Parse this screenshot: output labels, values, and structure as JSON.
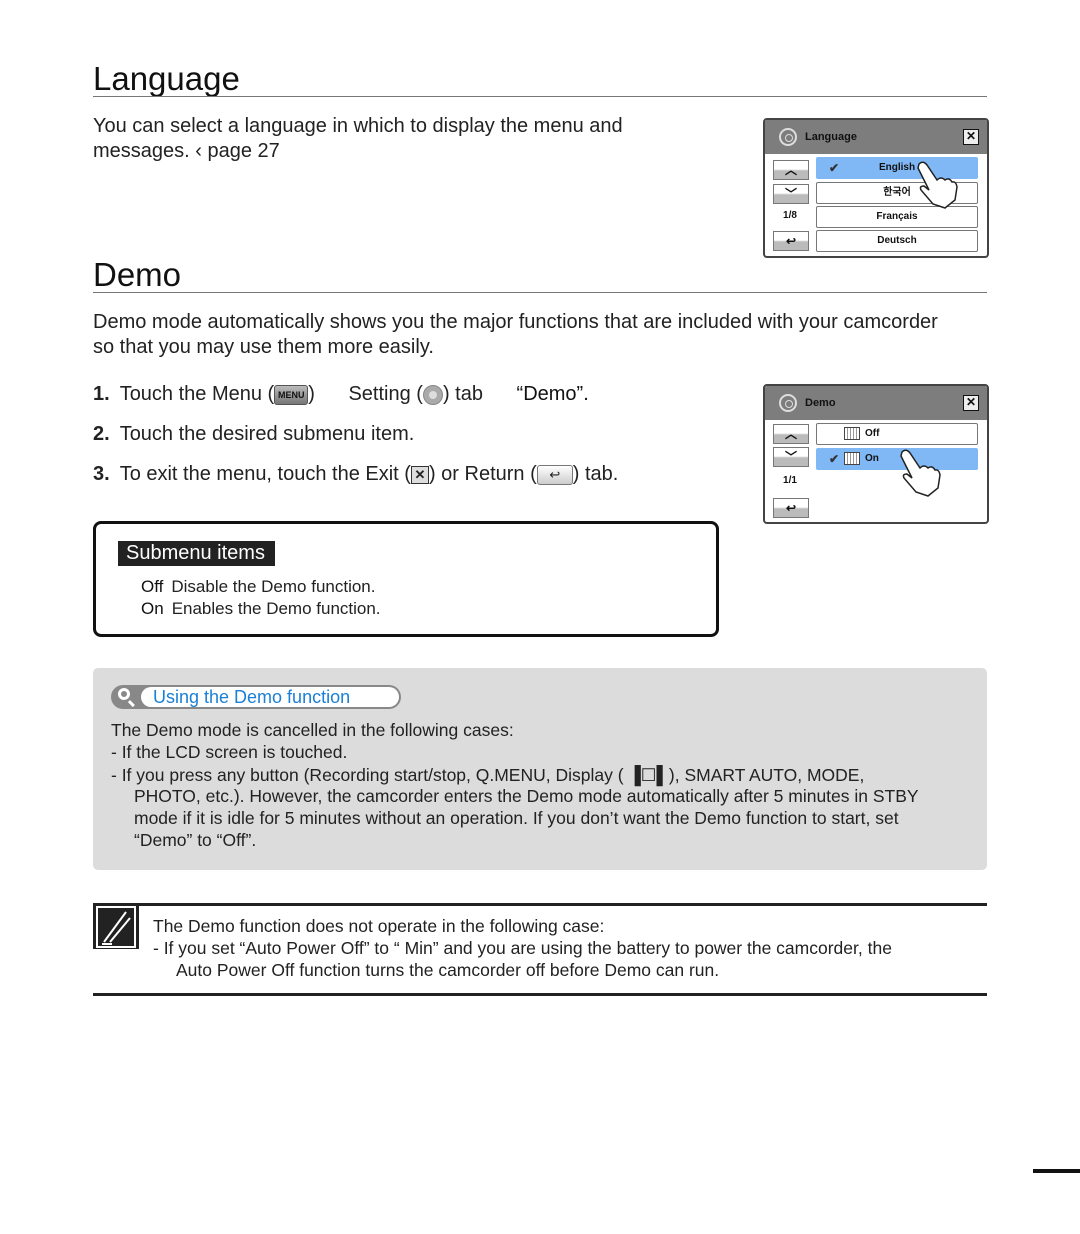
{
  "language_section": {
    "title": "Language",
    "description_line1": "You can select a language in which to display the menu and",
    "description_line2": "messages.  ‹ page 27",
    "screen": {
      "title": "Language",
      "page_indicator": "1/8",
      "options": [
        {
          "label": "English",
          "selected": true
        },
        {
          "label": "한국어",
          "selected": false
        },
        {
          "label": "Français",
          "selected": false
        },
        {
          "label": "Deutsch",
          "selected": false
        }
      ]
    }
  },
  "demo_section": {
    "title": "Demo",
    "description_line1": "Demo mode automatically shows you the major functions that are included with your camcorder",
    "description_line2": "so that you may use them more easily.",
    "steps": [
      {
        "num": "1.",
        "parts": [
          "Touch the Menu (",
          "MENU",
          ")",
          "Setting (",
          ") tab",
          "“Demo”."
        ]
      },
      {
        "num": "2.",
        "text": "Touch the desired submenu item."
      },
      {
        "num": "3.",
        "parts": [
          "To exit the menu, touch the Exit (",
          ") or Return (",
          ") tab."
        ]
      }
    ],
    "screen": {
      "title": "Demo",
      "page_indicator": "1/1",
      "options": [
        {
          "label": "Off",
          "selected": false
        },
        {
          "label": "On",
          "selected": true
        }
      ]
    },
    "submenu": {
      "title": "Submenu items",
      "items": [
        {
          "key": "Off",
          "desc": "Disable the Demo function."
        },
        {
          "key": "On",
          "desc": "Enables the Demo function."
        }
      ]
    }
  },
  "tip": {
    "title": "Using the Demo function",
    "intro": "The Demo mode is cancelled in the following cases:",
    "bullet1": "-   If the LCD screen is touched.",
    "bullet2_line1": "-   If you press any button (Recording start/stop, Q.MENU, Display (  ▐☐▌), SMART AUTO, MODE,",
    "bullet2_line2": "PHOTO, etc.). However, the camcorder enters the Demo mode automatically after 5 minutes in STBY",
    "bullet2_line3": "mode if it is idle for 5 minutes without an operation. If you don’t want the Demo function to start, set",
    "bullet2_line4": "“Demo” to “Off”."
  },
  "note": {
    "intro": "The Demo function does not operate in the following case:",
    "line1": "-   If you set “Auto Power Off” to “  Min” and you are using the battery to power the camcorder, the",
    "line2": "Auto Power Off function turns the camcorder off before Demo can run."
  },
  "colors": {
    "selected_option": "#7fb8f5",
    "tip_title": "#1a7fd6",
    "tip_background": "#dcdcdc"
  }
}
